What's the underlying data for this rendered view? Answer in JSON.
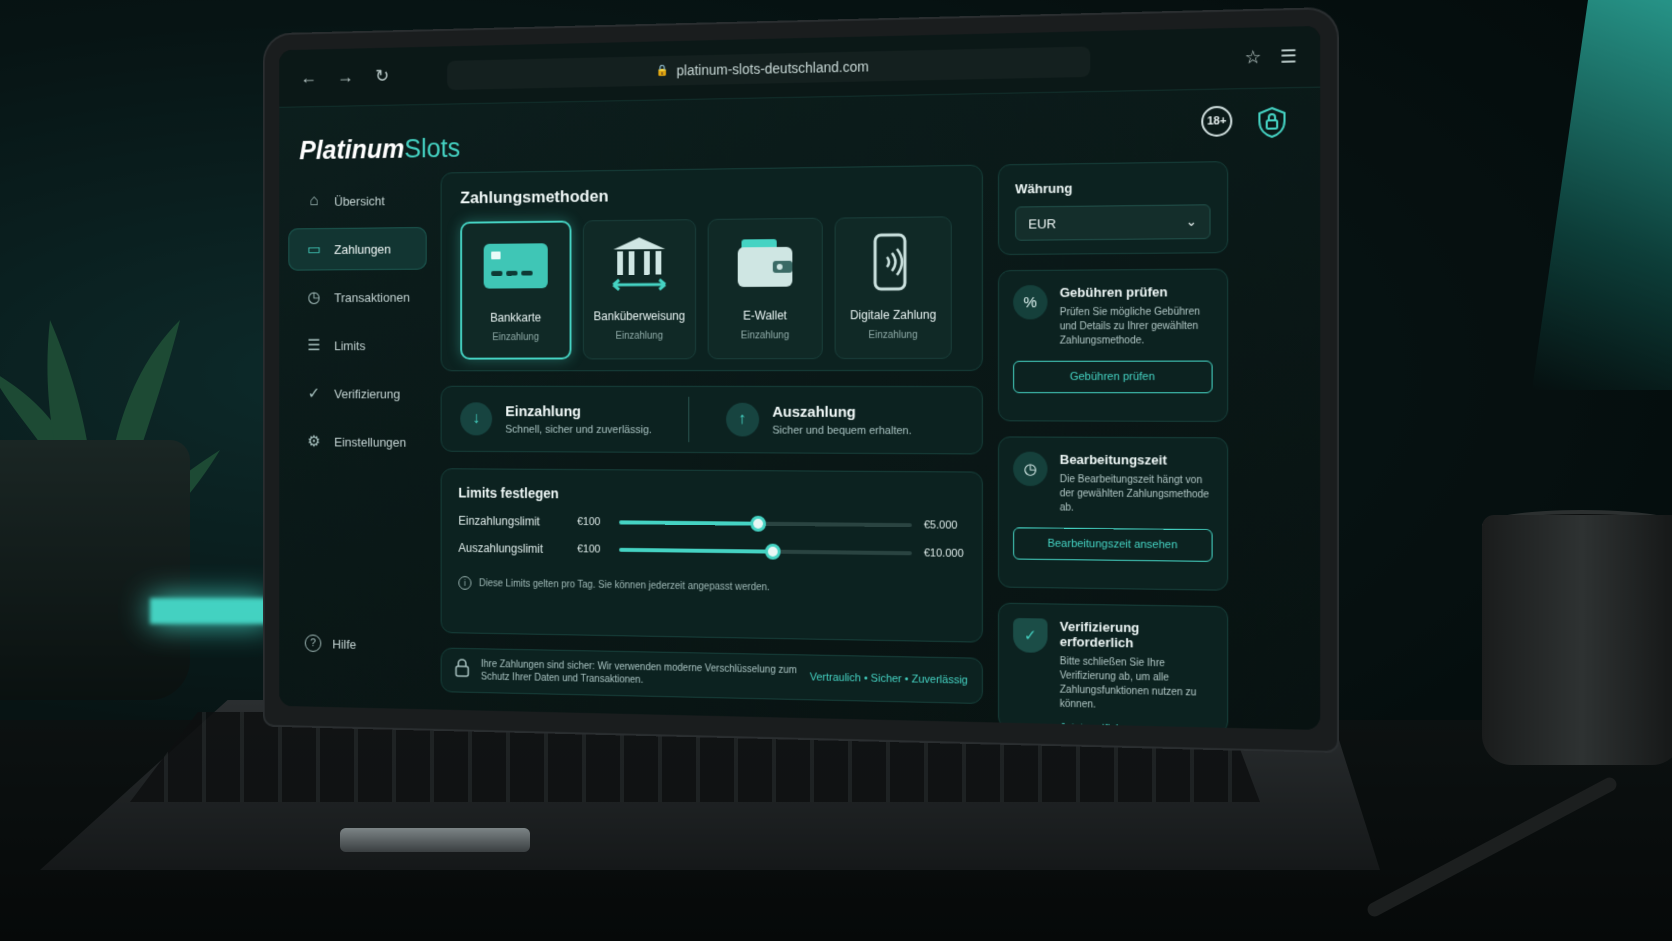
{
  "browser": {
    "url": "platinum-slots-deutschland.com",
    "back_icon": "←",
    "forward_icon": "→",
    "reload_icon": "↻",
    "lock_icon": "🔒",
    "star_icon": "☆",
    "menu_icon": "☰"
  },
  "brand": {
    "name_main": "Platinum",
    "name_accent": "Slots"
  },
  "header": {
    "age_badge": "18+"
  },
  "sidebar": {
    "items": [
      {
        "label": "Übersicht",
        "icon": "⌂"
      },
      {
        "label": "Zahlungen",
        "icon": "▭"
      },
      {
        "label": "Transaktionen",
        "icon": "◷"
      },
      {
        "label": "Limits",
        "icon": "☰"
      },
      {
        "label": "Verifizierung",
        "icon": "✓"
      },
      {
        "label": "Einstellungen",
        "icon": "⚙"
      }
    ],
    "help_label": "Hilfe",
    "help_icon": "?"
  },
  "methods": {
    "title": "Zahlungsmethoden",
    "cards": [
      {
        "label": "Bankkarte",
        "sub": "Einzahlung"
      },
      {
        "label": "Banküberweisung",
        "sub": "Einzahlung"
      },
      {
        "label": "E-Wallet",
        "sub": "Einzahlung"
      },
      {
        "label": "Digitale Zahlung",
        "sub": "Einzahlung"
      }
    ]
  },
  "deposit": {
    "title": "Einzahlung",
    "sub": "Schnell, sicher und zuverlässig.",
    "icon": "↓"
  },
  "withdraw": {
    "title": "Auszahlung",
    "sub": "Sicher und bequem erhalten.",
    "icon": "↑"
  },
  "limits": {
    "title": "Limits festlegen",
    "rows": [
      {
        "label": "Einzahlungslimit",
        "min": "€100",
        "max": "€5.000",
        "level": 0.48
      },
      {
        "label": "Auszahlungslimit",
        "min": "€100",
        "max": "€10.000",
        "level": 0.53
      }
    ],
    "note": "Diese Limits gelten pro Tag. Sie können jederzeit angepasst werden.",
    "note_icon": "i"
  },
  "security": {
    "text": "Ihre Zahlungen sind sicher: Wir verwenden moderne Verschlüsselung zum Schutz Ihrer Daten und Transaktionen.",
    "tags": "Vertraulich • Sicher • Zuverlässig"
  },
  "currency": {
    "title": "Währung",
    "value": "EUR",
    "chevron": "⌄"
  },
  "fees": {
    "title": "Gebühren prüfen",
    "desc": "Prüfen Sie mögliche Gebühren und Details zu Ihrer gewählten Zahlungsmethode.",
    "button": "Gebühren prüfen",
    "icon": "%"
  },
  "processing": {
    "title": "Bearbeitungszeit",
    "desc": "Die Bearbeitungszeit hängt von der gewählten Zahlungsmethode ab.",
    "button": "Bearbeitungszeit ansehen",
    "icon": "◷"
  },
  "verification": {
    "title": "Verifizierung erforderlich",
    "desc": "Bitte schließen Sie Ihre Verifizierung ab, um alle Zahlungsfunktionen nutzen zu können.",
    "link": "Jetzt verifizieren →",
    "icon": "✓"
  },
  "colors": {
    "accent": "#45d3c3",
    "background": "#081514"
  }
}
